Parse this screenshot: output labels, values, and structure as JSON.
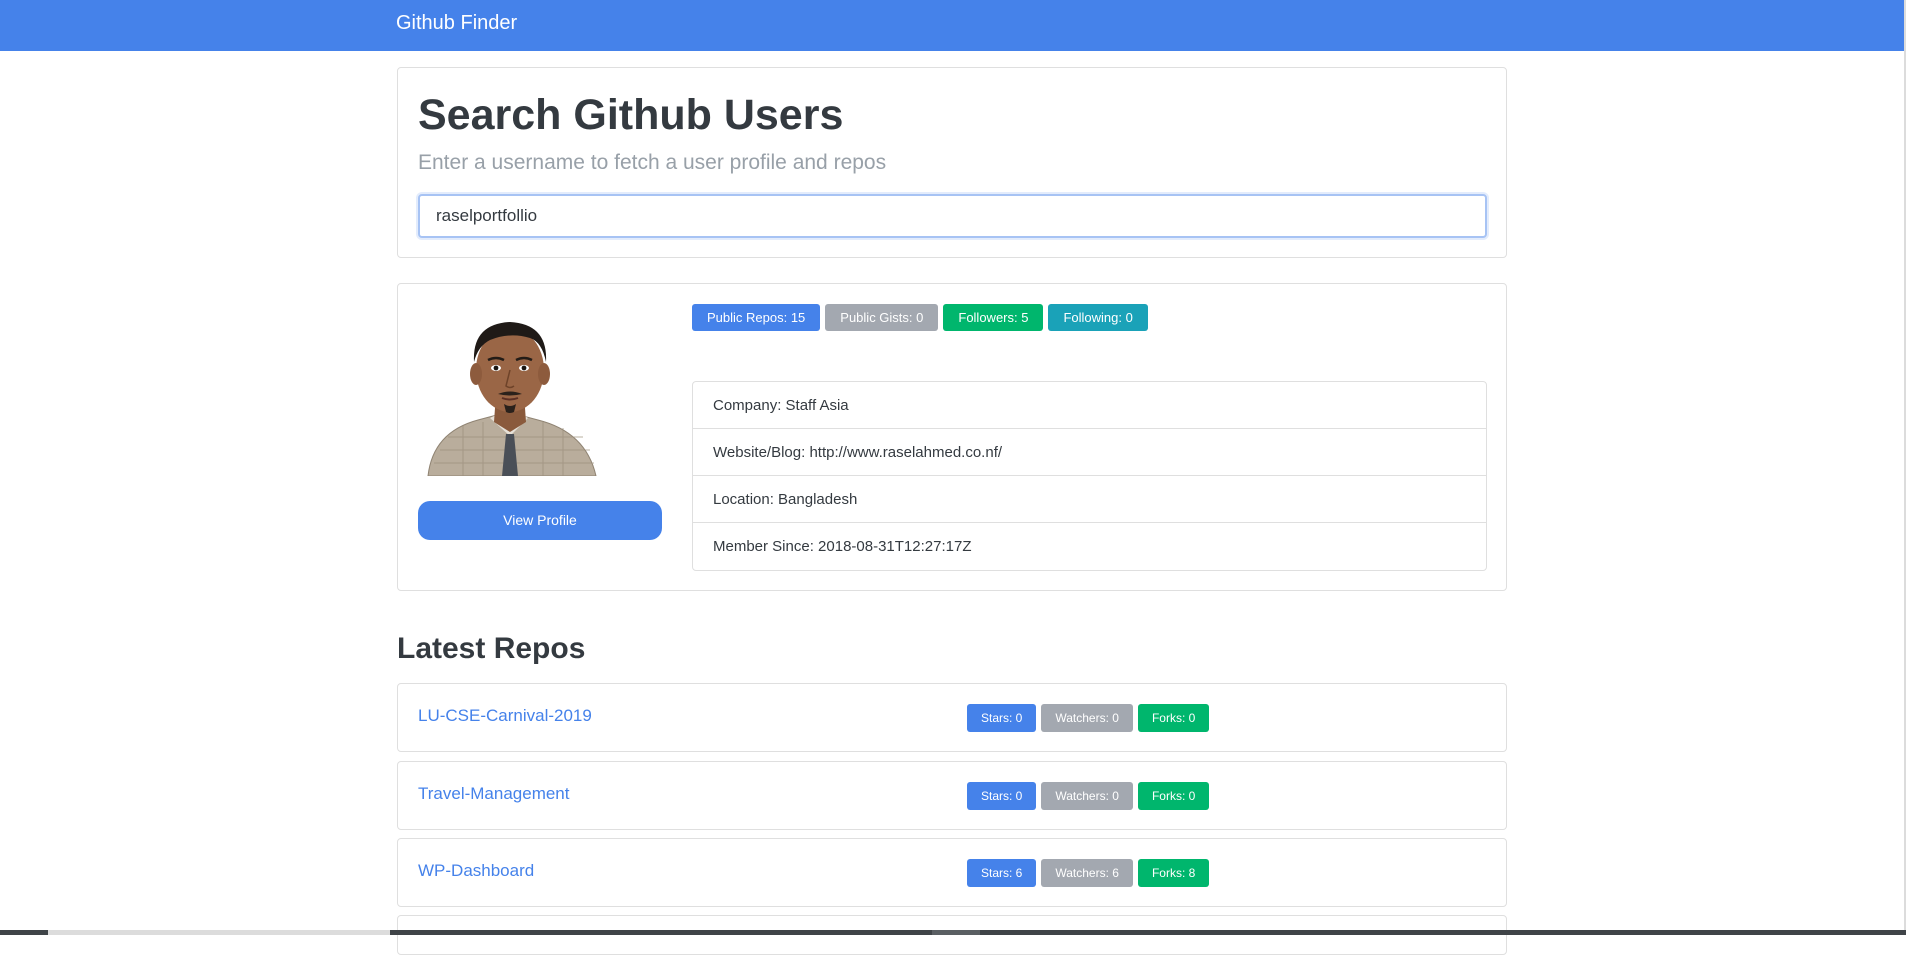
{
  "app": {
    "brand": "Github Finder"
  },
  "search": {
    "title": "Search Github Users",
    "subtitle": "Enter a username to fetch a user profile and repos",
    "value": "raselportfollio"
  },
  "profile": {
    "view_profile_label": "View Profile",
    "badges": [
      {
        "label": "Public Repos: 15",
        "color": "#4582ea"
      },
      {
        "label": "Public Gists: 0",
        "color": "#a3a8b0"
      },
      {
        "label": "Followers: 5",
        "color": "#00b66d"
      },
      {
        "label": "Following: 0",
        "color": "#1aa2b8"
      }
    ],
    "details": [
      "Company: Staff Asia",
      "Website/Blog: http://www.raselahmed.co.nf/",
      "Location: Bangladesh",
      "Member Since: 2018-08-31T12:27:17Z"
    ]
  },
  "repos": {
    "heading": "Latest Repos",
    "items": [
      {
        "name": "LU-CSE-Carnival-2019",
        "stars": "Stars: 0",
        "watchers": "Watchers: 0",
        "forks": "Forks: 0"
      },
      {
        "name": "Travel-Management",
        "stars": "Stars: 0",
        "watchers": "Watchers: 0",
        "forks": "Forks: 0"
      },
      {
        "name": "WP-Dashboard",
        "stars": "Stars: 6",
        "watchers": "Watchers: 6",
        "forks": "Forks: 8"
      }
    ]
  },
  "colors": {
    "primary": "#4582ea",
    "secondary": "#a3a8b0",
    "success": "#00b66d",
    "info": "#1aa2b8"
  }
}
